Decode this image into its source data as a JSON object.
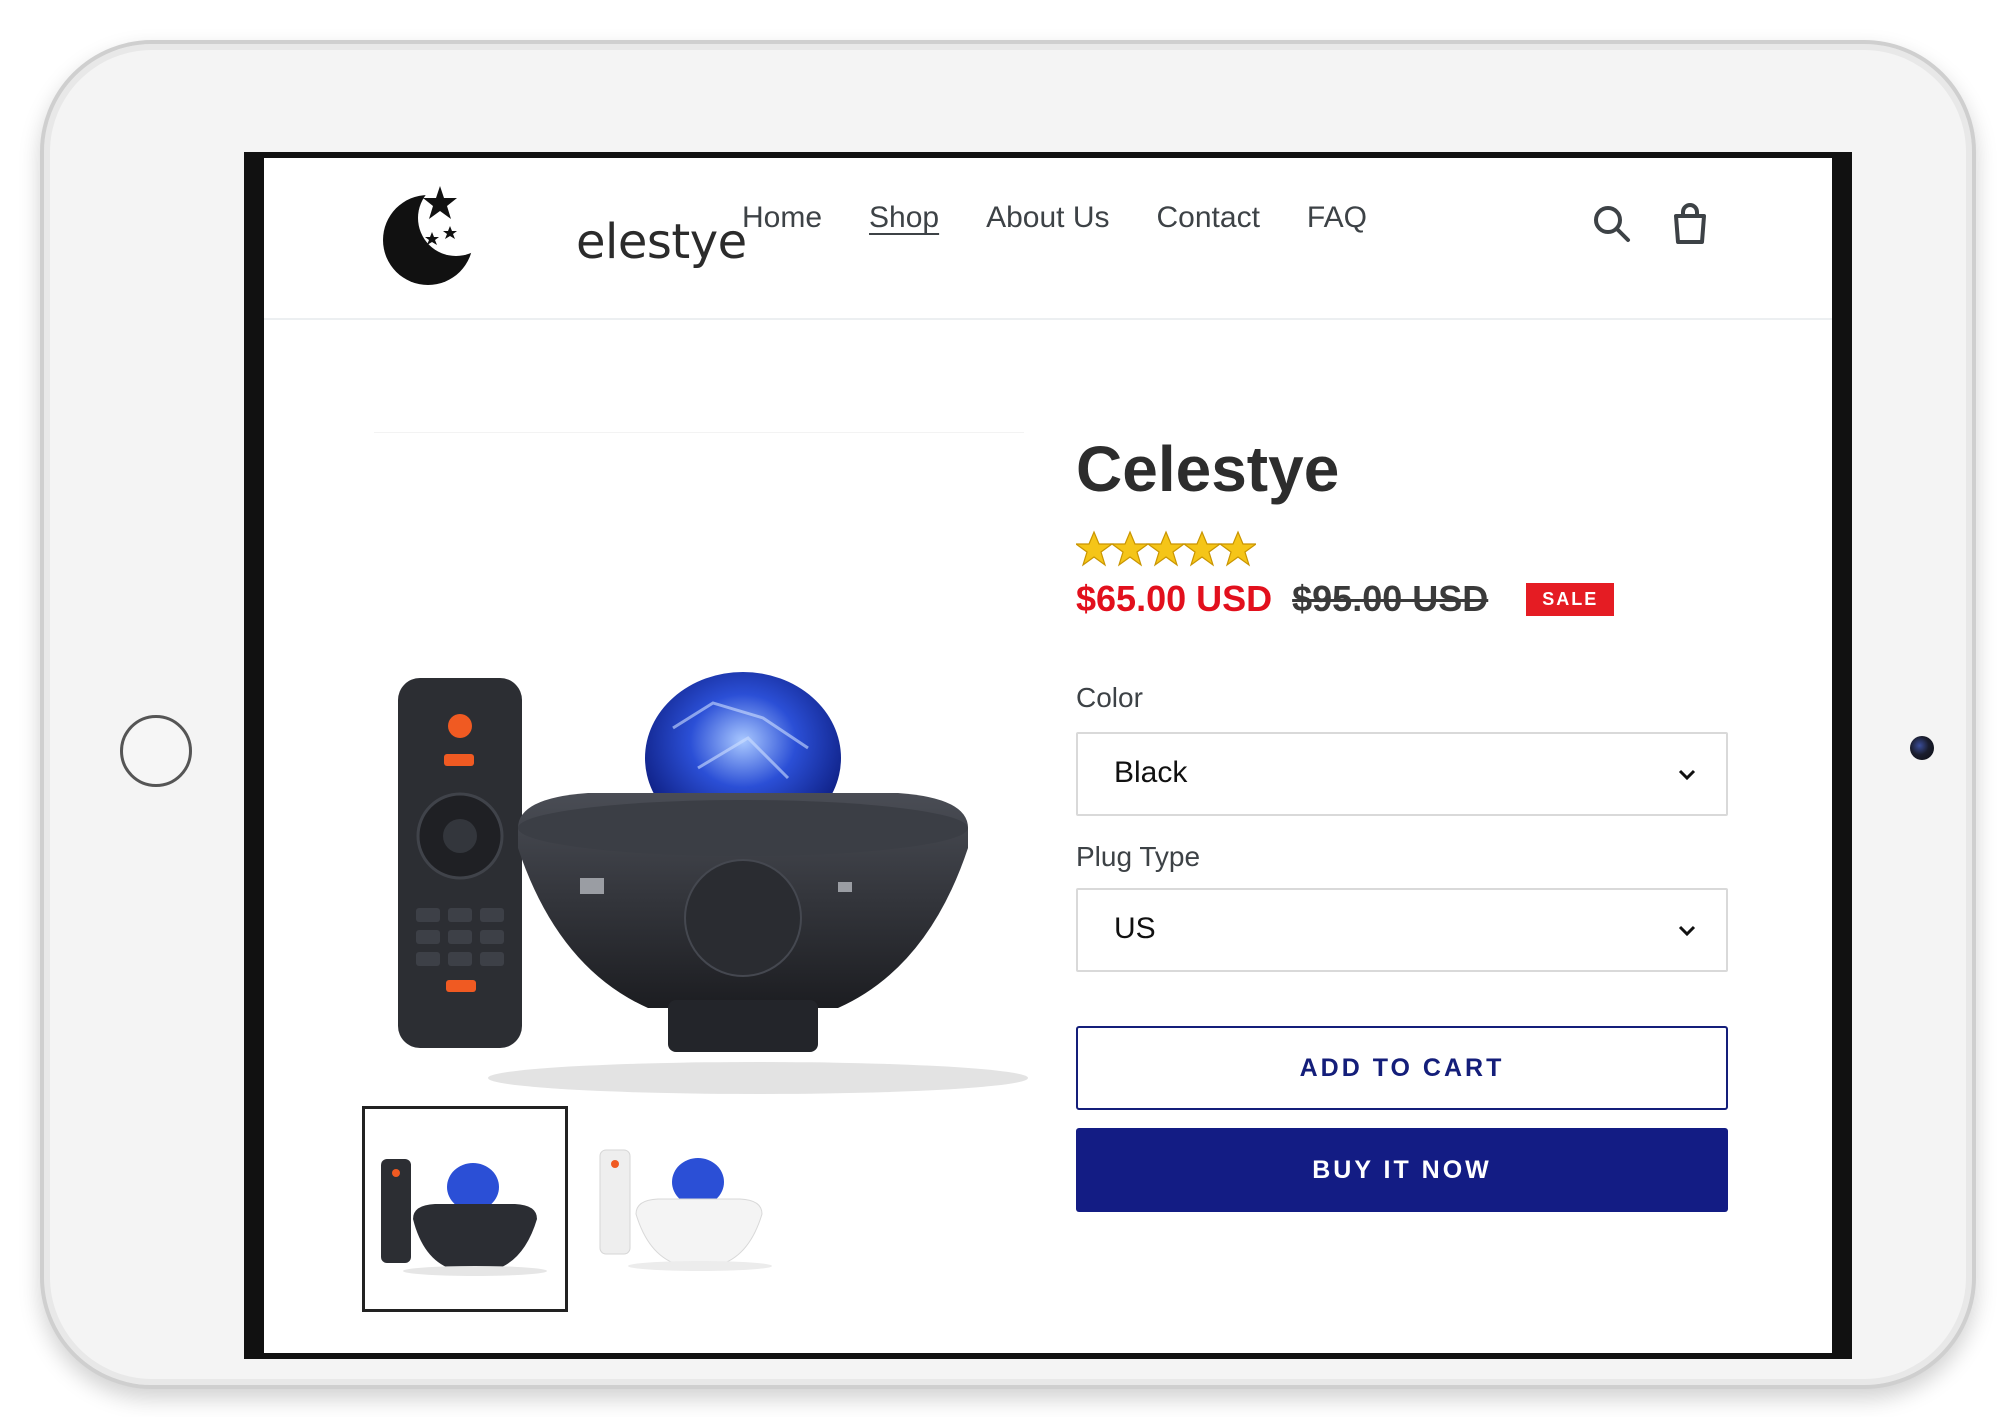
{
  "brand": {
    "logo_text": "elestye"
  },
  "nav": {
    "items": [
      "Home",
      "Shop",
      "About Us",
      "Contact",
      "FAQ"
    ],
    "active": "Shop"
  },
  "product": {
    "title": "Celestye",
    "rating": 5,
    "price_sale": "$65.00 USD",
    "price_original": "$95.00 USD",
    "badge": "SALE",
    "options": {
      "color": {
        "label": "Color",
        "value": "Black"
      },
      "plug": {
        "label": "Plug Type",
        "value": "US"
      }
    },
    "add_to_cart_label": "ADD TO CART",
    "buy_now_label": "BUY IT NOW"
  },
  "colors": {
    "accent": "#131c84",
    "sale_price": "#e2101d",
    "sale_badge": "#e51c23",
    "star": "#f5c518"
  },
  "icons": [
    "search-icon",
    "cart-icon",
    "chevron-down-icon",
    "star-icon"
  ]
}
